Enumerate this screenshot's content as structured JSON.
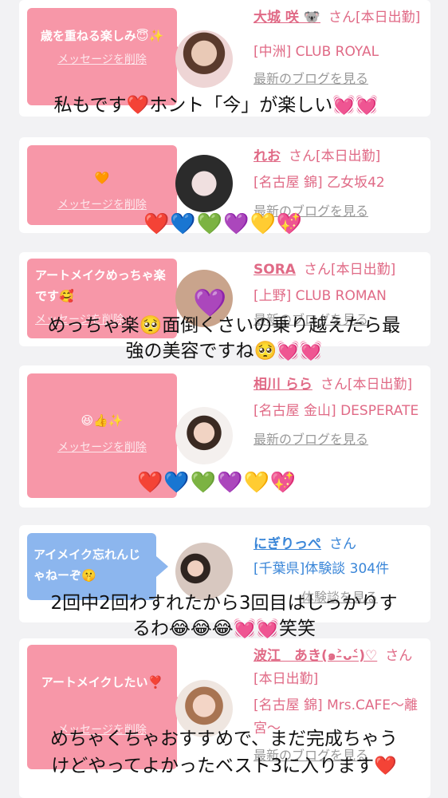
{
  "cards": [
    {
      "bubble": {
        "message": "歳を重ねる楽しみ😇✨",
        "delete": "メッセージを削除"
      },
      "name": "大城 咲 🐨",
      "suffix": "さん[本日出勤]",
      "store": "[中洲] CLUB ROYAL",
      "blog": "最新のブログを見る"
    },
    {
      "bubble": {
        "message": "🧡",
        "delete": "メッセージを削除"
      },
      "name": "れお",
      "suffix": "さん[本日出勤]",
      "store": "[名古屋 錦] 乙女坂42",
      "blog": "最新のブログを見る"
    },
    {
      "bubble": {
        "message": "アートメイクめっちゃ楽です🥰",
        "delete": "メッセージを削除"
      },
      "name": "SORA",
      "suffix": "さん[本日出勤]",
      "store": "[上野] CLUB ROMAN",
      "blog": "最新のブログを見る",
      "avatar_icon": "💜"
    },
    {
      "bubble": {
        "message": "😆👍✨",
        "delete": "メッセージを削除"
      },
      "name": "相川 らら",
      "suffix": "さん[本日出勤]",
      "store": "[名古屋 金山] DESPERATE",
      "blog": "最新のブログを見る"
    },
    {
      "bubble": {
        "message": "アイメイク忘れんじゃねーぞ🤫"
      },
      "name": "にぎりっぺ",
      "suffix": "さん",
      "store": "[千葉県]体験談 304件",
      "blog": "体験談を見る"
    },
    {
      "bubble": {
        "message": "アートメイクしたい❣️",
        "delete": "メッセージを削除"
      },
      "name": "波江　あき(๑˃̵ᴗ˂̵)♡",
      "suffix": "さん[本日出勤]",
      "store": "[名古屋 錦] Mrs.CAFE〜離宮〜",
      "blog": "最新のブログを見る"
    }
  ],
  "overlays": [
    {
      "text": "私もです❤️ホント「今」が楽しい💓💓"
    },
    {
      "text": "めっちゃ楽🥺面倒くさいの乗り越えたら最"
    },
    {
      "text": "強の美容ですね🥺💓💓"
    },
    {
      "text": "2回中2回わすれたから3回目はしっかりす"
    },
    {
      "text": "るわ😂😂😂💓💓笑笑"
    },
    {
      "text": "めちゃくちゃおすすめで、まだ完成ちゃう"
    },
    {
      "text": "けどやってよかったベスト3に入ります❤️"
    }
  ],
  "hearts": "❤️💙💚💜💛💖",
  "colors": {
    "pink_bubble": "#f797a8",
    "blue_bubble": "#8cb6ee",
    "link_pink": "#e06a86",
    "link_blue": "#3a86d8"
  }
}
